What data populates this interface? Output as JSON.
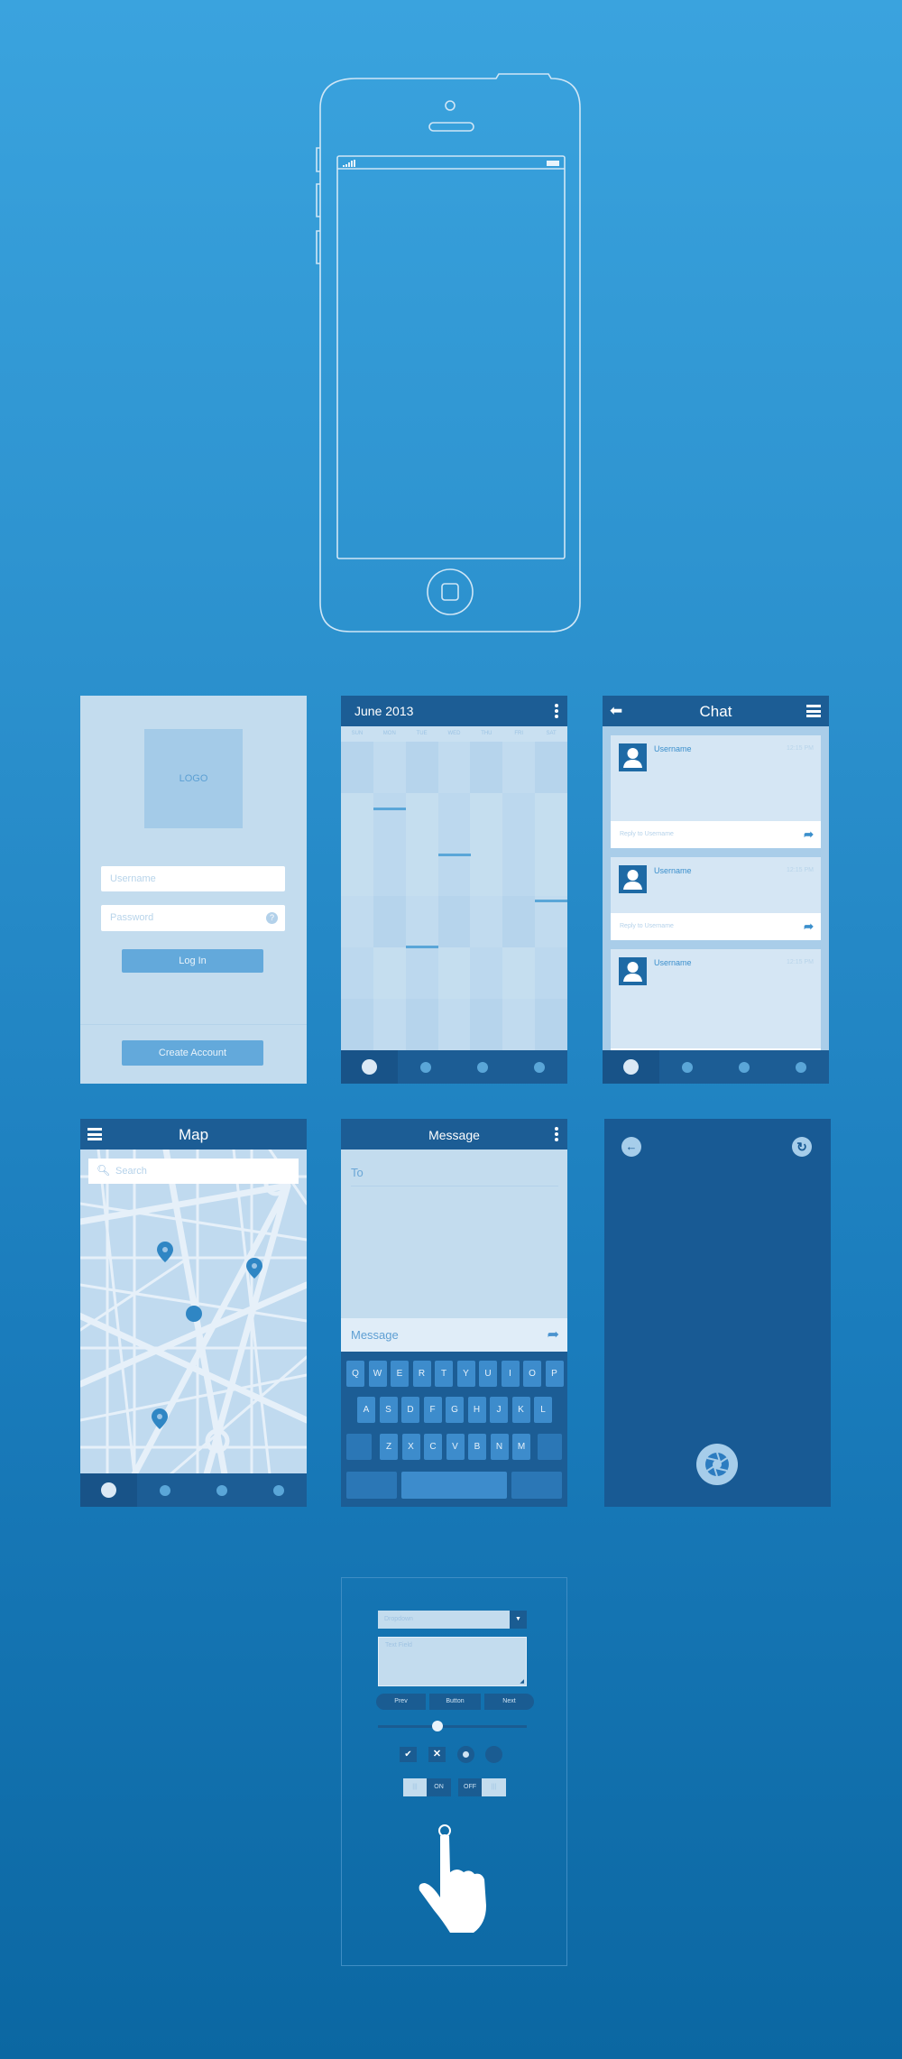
{
  "colors": {
    "header": "#1c5d95",
    "screen_bg": "#c3dcee",
    "accent": "#5aa6d8",
    "dark_panel": "#1a5c92"
  },
  "login": {
    "logo": "LOGO",
    "username_placeholder": "Username",
    "password_placeholder": "Password",
    "help_icon": "question-icon",
    "login_label": "Log In",
    "create_label": "Create Account"
  },
  "calendar": {
    "title": "June 2013",
    "days": [
      "SUN",
      "MON",
      "TUE",
      "WED",
      "THU",
      "FRI",
      "SAT"
    ]
  },
  "chat": {
    "title": "Chat",
    "messages": [
      {
        "user": "Username",
        "time": "12:15 PM",
        "reply": "Reply to Username"
      },
      {
        "user": "Username",
        "time": "12:15 PM",
        "reply": "Reply to Username"
      },
      {
        "user": "Username",
        "time": "12:15 PM"
      }
    ]
  },
  "map": {
    "title": "Map",
    "search_placeholder": "Search"
  },
  "message": {
    "title": "Message",
    "to_label": "To",
    "message_placeholder": "Message",
    "keys": [
      [
        "Q",
        "W",
        "E",
        "R",
        "T",
        "Y",
        "U",
        "I",
        "O",
        "P"
      ],
      [
        "A",
        "S",
        "D",
        "F",
        "G",
        "H",
        "J",
        "K",
        "L"
      ],
      [
        "Z",
        "X",
        "C",
        "V",
        "B",
        "N",
        "M"
      ]
    ]
  },
  "camera": {
    "icons": [
      "back-arrow-icon",
      "refresh-icon",
      "shutter-icon"
    ]
  },
  "widgets": {
    "dropdown": "Dropdown",
    "text_field": "Text Field",
    "prev": "Prev",
    "button": "Button",
    "next": "Next",
    "slider_value": 0.4,
    "on": "ON",
    "off": "OFF"
  }
}
